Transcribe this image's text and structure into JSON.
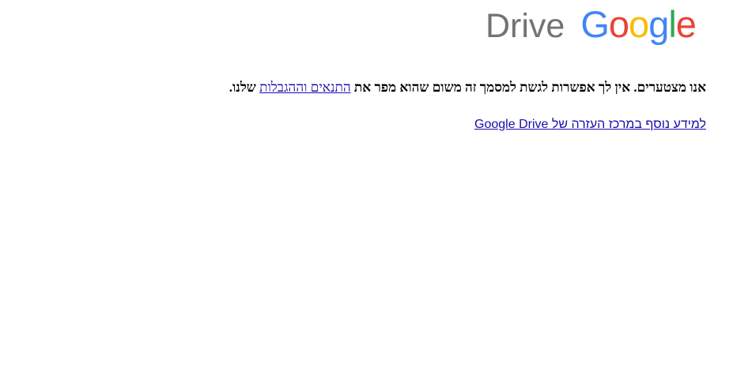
{
  "logo": {
    "product": "Drive",
    "brand_letters": [
      "G",
      "o",
      "o",
      "g",
      "l",
      "e"
    ]
  },
  "error": {
    "part1": "אנו מצטערים. אין לך אפשרות לגשת למסמך זה משום שהוא מפר את ",
    "terms_link": "התנאים וההגבלות",
    "part2": " שלנו."
  },
  "help_link": "למידע נוסף במרכז העזרה של Google Drive",
  "colors": {
    "drive_gray": "#737373",
    "google_blue": "#4285F4",
    "google_red": "#EA4335",
    "google_yellow": "#FBBC05",
    "google_green": "#34A853",
    "link": "#1a0dab"
  }
}
